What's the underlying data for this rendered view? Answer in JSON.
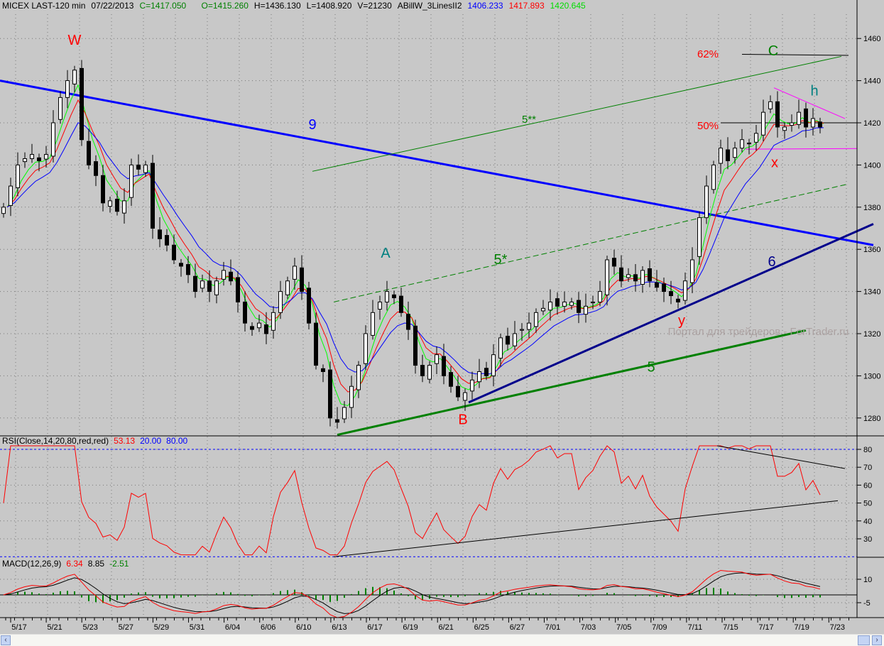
{
  "header": {
    "symbol": "MICEX LAST-120 min",
    "date": "07/22/2013",
    "close": "C=1417.050",
    "open": "O=1415.260",
    "high": "H=1436.130",
    "low": "L=1408.920",
    "volume": "V=21230",
    "indicator": "ABillW_3LinesII2",
    "ma_blue": "1406.233",
    "ma_red": "1417.893",
    "ma_green": "1420.645"
  },
  "rsi_header": {
    "label": "RSI(Close,14,20,80,red,red)",
    "value": "53.13",
    "low": "20.00",
    "high": "80.00"
  },
  "macd_header": {
    "label": "MACD(12,26,9)",
    "macd": "6.34",
    "signal": "8.85",
    "hist": "-2.51"
  },
  "colors": {
    "bg": "#c8c8c8",
    "ma_blue": "#0000ff",
    "ma_red": "#ff0000",
    "ma_green": "#00ff00",
    "rsi": "#ff0000",
    "macd_hist": "#008000",
    "trend9": "#0000ff",
    "trend6": "#00008b",
    "trend5": "#008000",
    "magenta": "#ff00ff",
    "watermark": "#a89c9c"
  },
  "scrollbar": {
    "left": "‹",
    "right": "›"
  },
  "chart_data": {
    "type": "candlestick",
    "price_axis": {
      "min": 1270,
      "max": 1465,
      "ticks": [
        1280,
        1300,
        1320,
        1340,
        1360,
        1380,
        1400,
        1420,
        1440,
        1460
      ]
    },
    "rsi_axis": {
      "ticks": [
        30,
        40,
        50,
        60,
        70,
        80
      ],
      "levels": [
        20,
        80
      ]
    },
    "macd_axis": {
      "ticks": [
        10,
        -5
      ]
    },
    "x_labels": [
      "5/17",
      "5/21",
      "5/23",
      "5/27",
      "5/29",
      "5/31",
      "6/04",
      "6/06",
      "6/10",
      "6/13",
      "6/17",
      "6/19",
      "6/21",
      "6/25",
      "6/27",
      "7/01",
      "7/03",
      "7/05",
      "7/09",
      "7/11",
      "7/15",
      "7/17",
      "7/19",
      "7/23"
    ],
    "closes": [
      1380,
      1390,
      1400,
      1403,
      1405,
      1402,
      1405,
      1420,
      1432,
      1440,
      1445,
      1412,
      1400,
      1395,
      1382,
      1383,
      1378,
      1383,
      1400,
      1398,
      1400,
      1370,
      1365,
      1362,
      1355,
      1352,
      1348,
      1340,
      1345,
      1340,
      1345,
      1350,
      1345,
      1335,
      1325,
      1322,
      1325,
      1320,
      1330,
      1340,
      1345,
      1352,
      1340,
      1325,
      1305,
      1302,
      1280,
      1278,
      1285,
      1295,
      1305,
      1320,
      1330,
      1335,
      1340,
      1337,
      1330,
      1322,
      1305,
      1300,
      1305,
      1310,
      1300,
      1295,
      1290,
      1292,
      1298,
      1302,
      1300,
      1310,
      1318,
      1315,
      1320,
      1322,
      1325,
      1330,
      1332,
      1335,
      1333,
      1335,
      1335,
      1330,
      1333,
      1335,
      1340,
      1355,
      1352,
      1345,
      1348,
      1345,
      1350,
      1345,
      1342,
      1340,
      1338,
      1335,
      1345,
      1355,
      1375,
      1390,
      1400,
      1408,
      1402,
      1408,
      1412,
      1410,
      1415,
      1425,
      1430,
      1418,
      1418,
      1420,
      1425,
      1418,
      1422,
      1418
    ],
    "trendlines": [
      {
        "name": "9",
        "color": "#0000ff",
        "from": [
          -0.5,
          1440
        ],
        "to": [
          122.5,
          1362
        ],
        "style": "thick"
      },
      {
        "name": "6",
        "color": "#00008b",
        "from": [
          65.5,
          1287.4
        ],
        "to": [
          122.5,
          1372
        ],
        "style": "thick"
      },
      {
        "name": "5",
        "color": "#008000",
        "from": [
          47,
          1272
        ],
        "to": [
          113,
          1321.6
        ],
        "style": "thick"
      },
      {
        "name": "5*",
        "color": "#008000",
        "from": [
          46.5,
          1335
        ],
        "to": [
          119,
          1391
        ],
        "style": "dashed"
      },
      {
        "name": "5**",
        "color": "#008000",
        "from": [
          43.5,
          1397
        ],
        "to": [
          118,
          1451.5
        ],
        "style": "thin"
      },
      {
        "name": "h-top",
        "color": "#ff00ff",
        "from": [
          108.5,
          1436.6
        ],
        "to": [
          118.5,
          1422
        ],
        "style": "thin"
      },
      {
        "name": "h-bottom",
        "color": "#ff00ff",
        "from": [
          104.5,
          1407.5
        ],
        "to": [
          120.2,
          1407.8
        ],
        "style": "thin"
      },
      {
        "name": "50%",
        "color": "#000000",
        "from": [
          101,
          1420
        ],
        "to": [
          120.2,
          1420
        ],
        "style": "thin"
      },
      {
        "name": "C",
        "color": "#000000",
        "from": [
          104,
          1452.5
        ],
        "to": [
          119,
          1452
        ],
        "style": "thin"
      }
    ],
    "rsi_trendlines": [
      {
        "from": [
          46.5,
          20
        ],
        "to": [
          117.5,
          51.3
        ]
      },
      {
        "from": [
          100.5,
          82
        ],
        "to": [
          118.5,
          69.3
        ]
      }
    ],
    "annotations": [
      {
        "text": "W",
        "color": "#ff0000",
        "at": [
          10,
          1457
        ]
      },
      {
        "text": "9",
        "color": "#0000ff",
        "at": [
          43.5,
          1417
        ]
      },
      {
        "text": "5**",
        "color": "#008000",
        "at": [
          74,
          1420
        ]
      },
      {
        "text": "A",
        "color": "#008080",
        "at": [
          53.8,
          1356
        ]
      },
      {
        "text": "5*",
        "color": "#008000",
        "at": [
          70,
          1353
        ]
      },
      {
        "text": "B",
        "color": "#ff0000",
        "at": [
          64.7,
          1277
        ]
      },
      {
        "text": "5",
        "color": "#008000",
        "at": [
          91.2,
          1302
        ]
      },
      {
        "text": "6",
        "color": "#00008b",
        "at": [
          108.2,
          1352
        ]
      },
      {
        "text": "y",
        "color": "#ff0000",
        "at": [
          95.5,
          1324
        ]
      },
      {
        "text": "x",
        "color": "#ff0000",
        "at": [
          108.6,
          1399
        ]
      },
      {
        "text": "50%",
        "color": "#ff0000",
        "at": [
          99.2,
          1417
        ]
      },
      {
        "text": "62%",
        "color": "#ff0000",
        "at": [
          99.2,
          1451
        ]
      },
      {
        "text": "C",
        "color": "#008000",
        "at": [
          108.4,
          1452
        ]
      },
      {
        "text": "h",
        "color": "#008080",
        "at": [
          114.2,
          1433
        ]
      }
    ],
    "watermark": "Портал для трейдеров - ForTrader.ru"
  }
}
